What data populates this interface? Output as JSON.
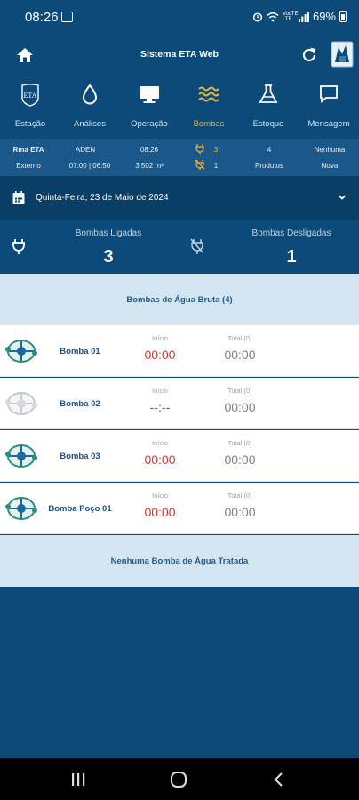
{
  "status_bar": {
    "time": "08:26",
    "network": "VoLTE LTE",
    "battery": "69%"
  },
  "header": {
    "title": "Sistema ETA Web"
  },
  "nav": {
    "items": [
      {
        "label": "Estação",
        "active": false
      },
      {
        "label": "Análises",
        "active": false
      },
      {
        "label": "Operação",
        "active": false
      },
      {
        "label": "Bombas",
        "active": true
      },
      {
        "label": "Estoque",
        "active": false
      },
      {
        "label": "Mensagem",
        "active": false
      }
    ]
  },
  "info": {
    "station": "Rma ETA",
    "station_sub": "Externo",
    "user": "ADEN",
    "shift": "07:00 | 06:50",
    "time": "08:26",
    "volume": "3.502 m³",
    "pumps_on": "3",
    "pumps_off": "1",
    "products_count": "4",
    "products_label": "Produtos",
    "messages": "Nenhuma",
    "messages_sub": "Nova"
  },
  "date": {
    "text": "Quinta-Feira, 23 de Maio de 2024"
  },
  "stats": {
    "on_label": "Bombas Ligadas",
    "on_value": "3",
    "off_label": "Bombas Desligadas",
    "off_value": "1"
  },
  "raw_section": {
    "title": "Bombas de Água Bruta (4)"
  },
  "pumps": [
    {
      "name": "Bomba 01",
      "inicio_label": "Início",
      "inicio": "00:00",
      "total_label": "Total (0)",
      "total": "00:00",
      "active": true
    },
    {
      "name": "Bomba 02",
      "inicio_label": "Início",
      "inicio": "--:--",
      "total_label": "Total (0)",
      "total": "00:00",
      "active": false
    },
    {
      "name": "Bomba 03",
      "inicio_label": "Início",
      "inicio": "00:00",
      "total_label": "Total (0)",
      "total": "00:00",
      "active": true
    },
    {
      "name": "Bomba Poço 01",
      "inicio_label": "Início",
      "inicio": "00:00",
      "total_label": "Total (0)",
      "total": "00:00",
      "active": true
    }
  ],
  "treated_section": {
    "title": "Nenhuma Bomba de Água Tratada"
  },
  "colors": {
    "header": "#0c4a79",
    "accent": "#e9b43c",
    "red": "#d0352e",
    "section_bg": "#d4e5f2"
  }
}
